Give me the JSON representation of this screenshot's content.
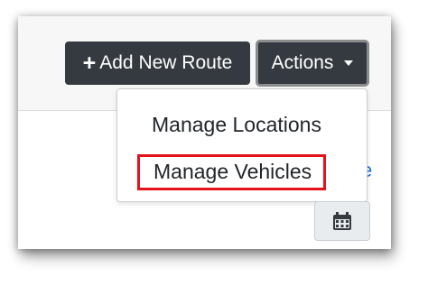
{
  "toolbar": {
    "add_route_label": "Add New Route",
    "add_route_icon": "plus-icon",
    "actions_label": "Actions"
  },
  "dropdown": {
    "items": [
      {
        "label": "Manage Locations"
      },
      {
        "label": "Manage Vehicles",
        "highlighted": true
      }
    ]
  },
  "partial_link_text": "e",
  "calendar_button": {
    "icon": "calendar-icon"
  },
  "colors": {
    "button_dark": "#343a40",
    "highlight_border": "#e3121b",
    "header_bg": "#f7f7f7",
    "calendar_bg": "#e9ecef",
    "link_blue": "#1a73e8"
  }
}
